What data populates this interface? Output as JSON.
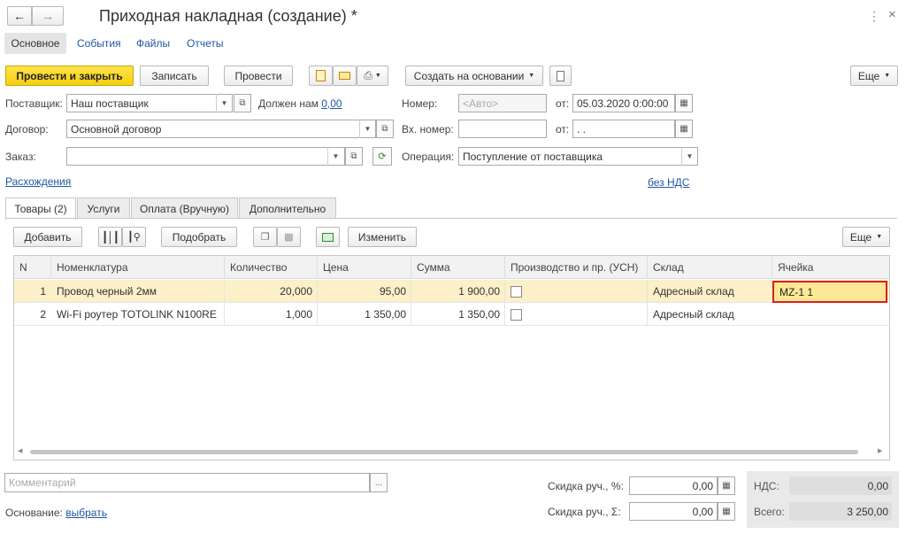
{
  "window": {
    "title": "Приходная накладная (создание) *"
  },
  "nav_tabs": [
    "Основное",
    "События",
    "Файлы",
    "Отчеты"
  ],
  "toolbar": {
    "post_close": "Провести и закрыть",
    "save": "Записать",
    "post": "Провести",
    "create_based": "Создать на основании",
    "more": "Еще"
  },
  "form": {
    "supplier_label": "Поставщик:",
    "supplier_value": "Наш поставщик",
    "owes_label": "Должен нам",
    "owes_value": "0,00",
    "number_label": "Номер:",
    "number_placeholder": "<Авто>",
    "from_label": "от:",
    "date_value": "05.03.2020  0:00:00",
    "contract_label": "Договор:",
    "contract_value": "Основной договор",
    "in_number_label": "Вх. номер:",
    "in_number_value": "",
    "in_date_value": " .  .",
    "order_label": "Заказ:",
    "order_value": "",
    "operation_label": "Операция:",
    "operation_value": "Поступление от поставщика",
    "discrepancies_link": "Расхождения",
    "vat_link": "без НДС"
  },
  "inner_tabs": [
    "Товары (2)",
    "Услуги",
    "Оплата (Вручную)",
    "Дополнительно"
  ],
  "table_toolbar": {
    "add": "Добавить",
    "pick": "Подобрать",
    "change": "Изменить",
    "more": "Еще"
  },
  "table": {
    "columns": [
      "N",
      "Номенклатура",
      "Количество",
      "Цена",
      "Сумма",
      "Производство и пр. (УСН)",
      "Склад",
      "Ячейка"
    ],
    "rows": [
      {
        "n": "1",
        "item": "Провод черный 2мм",
        "qty": "20,000",
        "price": "95,00",
        "sum": "1 900,00",
        "prod": false,
        "warehouse": "Адресный склад",
        "cell": "MZ-1 1"
      },
      {
        "n": "2",
        "item": "Wi-Fi роутер TOTOLINK N100RE",
        "qty": "1,000",
        "price": "1 350,00",
        "sum": "1 350,00",
        "prod": false,
        "warehouse": "Адресный склад",
        "cell": ""
      }
    ]
  },
  "footer": {
    "comment_placeholder": "Комментарий",
    "discount_pct_label": "Скидка руч., %:",
    "discount_pct_value": "0,00",
    "discount_sum_label": "Скидка руч., Σ:",
    "discount_sum_value": "0,00",
    "vat_label": "НДС:",
    "vat_value": "0,00",
    "total_label": "Всего:",
    "total_value": "3 250,00",
    "basis_label": "Основание:",
    "basis_link": "выбрать"
  },
  "colors": {
    "accent_yellow": "#f6cf10",
    "selected_row": "#fbf0c8",
    "highlight_border": "#d81e1e",
    "link": "#1f57a4"
  }
}
